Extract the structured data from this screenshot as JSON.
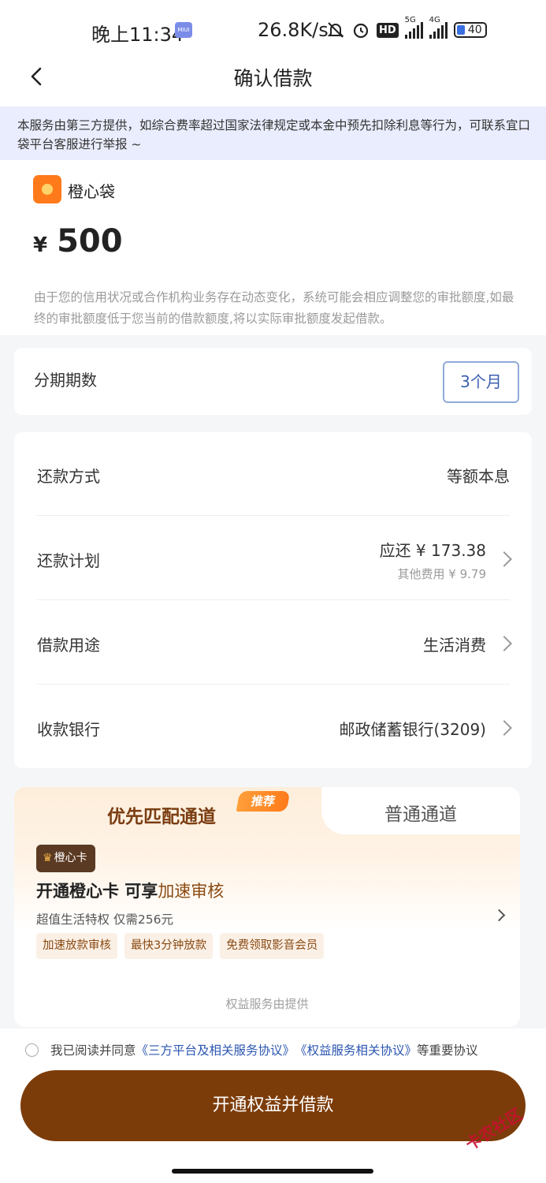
{
  "status_bar": {
    "time": "晚上11:34",
    "miui_label": "MIUI",
    "net_speed": "26.8K/s",
    "hd_label": "HD",
    "signal1_label": "5G",
    "signal2_label": "4G",
    "battery": "40"
  },
  "nav": {
    "title": "确认借款",
    "back_icon": "chevron-left-icon"
  },
  "notice": {
    "text": "本服务由第三方提供，如综合费率超过国家法律规定或本金中预先扣除利息等行为，可联系宜口袋平台客服进行举报 ~"
  },
  "loan": {
    "brand_name": "橙心袋",
    "currency": "¥",
    "amount": "500",
    "credit_note": "由于您的信用状况或合作机构业务存在动态变化，系统可能会相应调整您的审批额度,如最终的审批额度低于您当前的借款额度,将以实际审批额度发起借款。"
  },
  "term": {
    "label": "分期期数",
    "selected": "3个月"
  },
  "details": {
    "repay_method_label": "还款方式",
    "repay_method_value": "等额本息",
    "plan_label": "还款计划",
    "plan_due": "应还 ¥ 173.38",
    "plan_fee": "其他费用 ¥ 9.79",
    "purpose_label": "借款用途",
    "purpose_value": "生活消费",
    "bank_label": "收款银行",
    "bank_value": "邮政储蓄银行(3209)"
  },
  "channel": {
    "priority_tab": "优先匹配通道",
    "recommend_badge": "推荐",
    "normal_tab": "普通通道",
    "card_tag": "橙心卡",
    "promo_title_main": "开通橙心卡 可享",
    "promo_title_highlight": "加速审核",
    "promo_sub": "超值生活特权 仅需256元",
    "chips": [
      "加速放款审核",
      "最快3分钟放款",
      "免费领取影音会员"
    ],
    "provider_note": "权益服务由提供"
  },
  "agreement": {
    "prefix": "我已阅读并同意",
    "link1": "《三方平台及相关服务协议》",
    "link2": "《权益服务相关协议》",
    "suffix": "等重要协议"
  },
  "cta": {
    "label": "开通权益并借款"
  },
  "watermark": "卡农社区",
  "colors": {
    "accent_brown": "#7c3c0a",
    "link_blue": "#2b56b0",
    "notice_bg": "#eaedfd",
    "brand_orange": "#ff7a1a"
  }
}
